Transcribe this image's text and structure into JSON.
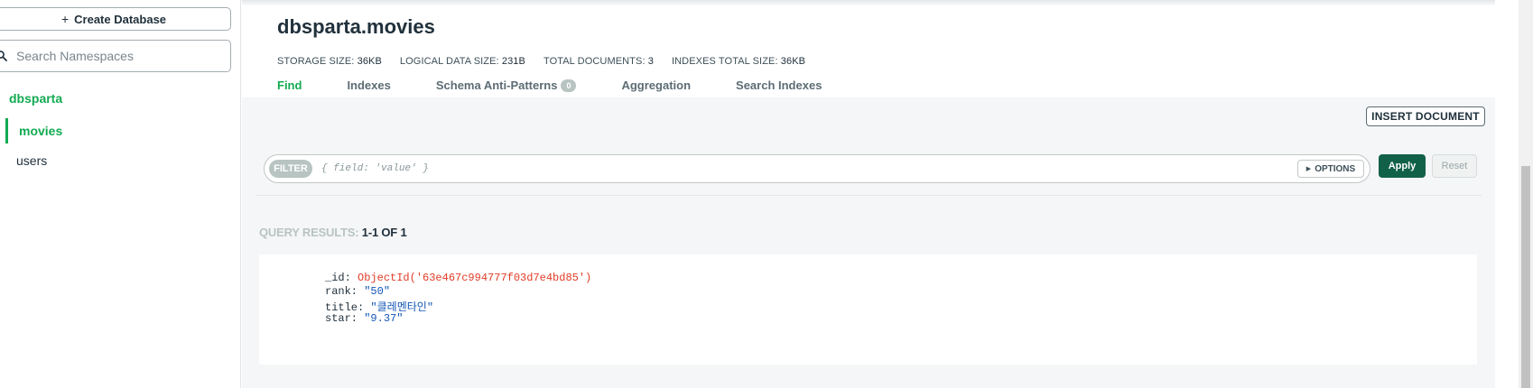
{
  "sidebar": {
    "create_database_label": "Create Database",
    "search_placeholder": "Search Namespaces",
    "database": "dbsparta",
    "collections": [
      "movies",
      "users"
    ]
  },
  "header": {
    "title": "dbsparta.movies",
    "stats": [
      {
        "label": "STORAGE SIZE:",
        "value": "36KB"
      },
      {
        "label": "LOGICAL DATA SIZE:",
        "value": "231B"
      },
      {
        "label": "TOTAL DOCUMENTS:",
        "value": "3"
      },
      {
        "label": "INDEXES TOTAL SIZE:",
        "value": "36KB"
      }
    ],
    "tabs": [
      "Find",
      "Indexes",
      "Schema Anti-Patterns",
      "Aggregation",
      "Search Indexes"
    ],
    "active_tab": "Find",
    "schema_badge": "0"
  },
  "toolbar": {
    "insert_document_label": "INSERT DOCUMENT",
    "filter_label": "FILTER",
    "filter_placeholder": "{ field: 'value' }",
    "options_label": "OPTIONS",
    "apply_label": "Apply",
    "reset_label": "Reset"
  },
  "results": {
    "label": "QUERY RESULTS:",
    "count": "1-1 OF 1"
  },
  "document": {
    "fields": [
      {
        "key": "_id:",
        "value": "ObjectId('63e467c994777f03d7e4bd85')",
        "kind": "oid"
      },
      {
        "key": "rank:",
        "value": "\"50\"",
        "kind": "str"
      },
      {
        "key": "title:",
        "value": "\"클레멘타인\"",
        "kind": "str"
      },
      {
        "key": "star:",
        "value": "\"9.37\"",
        "kind": "str"
      }
    ]
  },
  "colors": {
    "accent_green": "#13aa52",
    "apply_green": "#116149",
    "oid_red": "#e03c26",
    "string_blue": "#1254b7"
  }
}
